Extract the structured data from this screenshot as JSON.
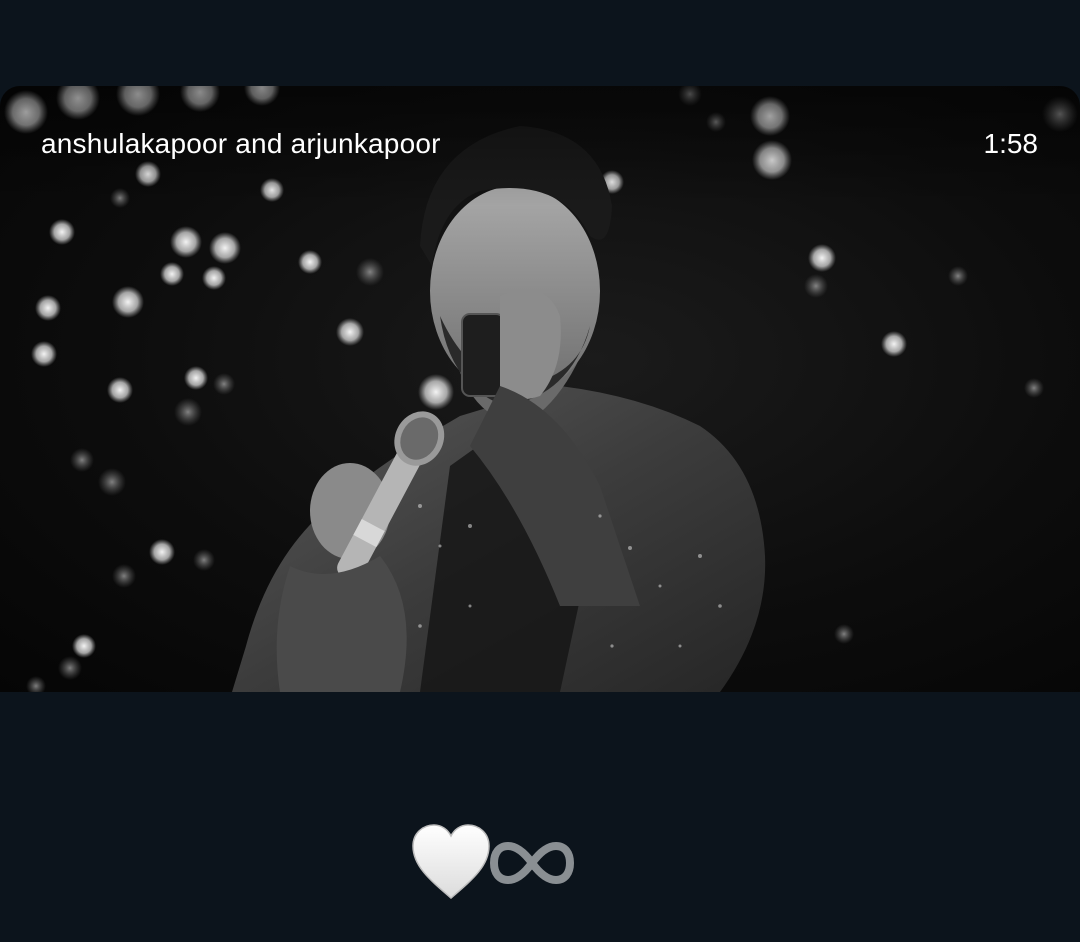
{
  "story": {
    "caption": "anshulakapoor and arjunkapoor",
    "duration": "1:58"
  },
  "reactions": {
    "heart_icon": "white-heart-icon",
    "infinity_icon": "infinity-icon"
  },
  "colors": {
    "background": "#0c141c",
    "text": "#ffffff",
    "infinity": "#8a8f93"
  }
}
